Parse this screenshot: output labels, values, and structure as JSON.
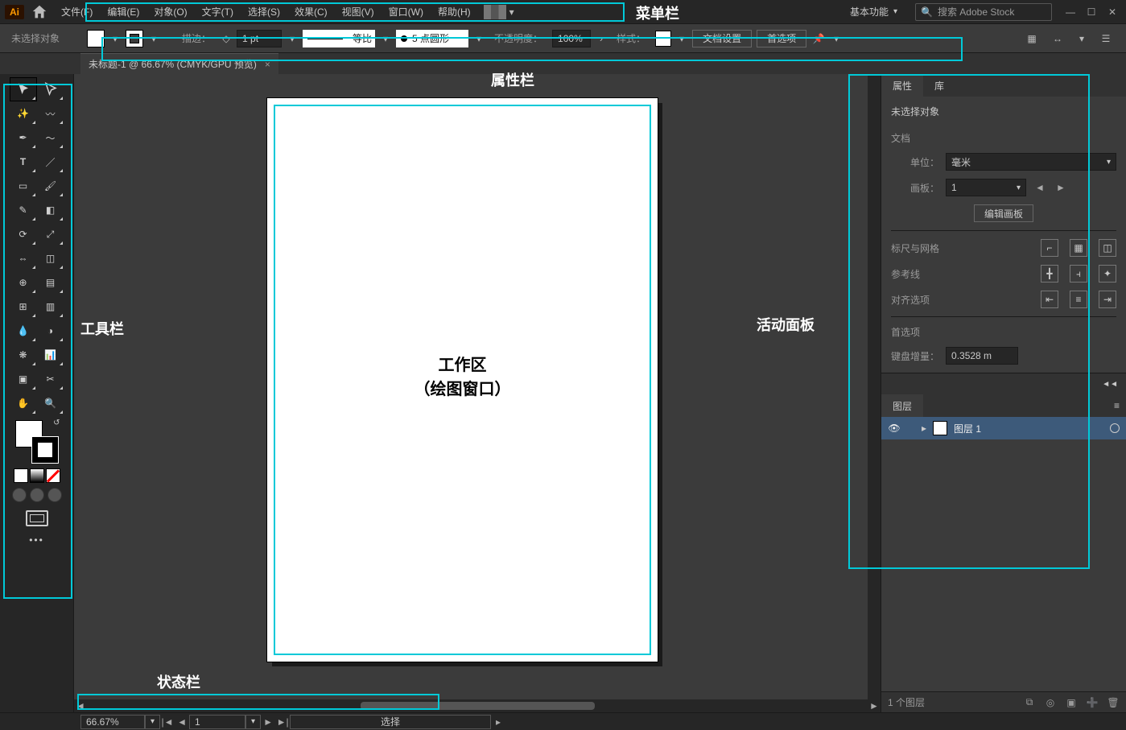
{
  "menubar": {
    "items": [
      "文件(F)",
      "编辑(E)",
      "对象(O)",
      "文字(T)",
      "选择(S)",
      "效果(C)",
      "视图(V)",
      "窗口(W)",
      "帮助(H)"
    ]
  },
  "workspace": {
    "label": "基本功能"
  },
  "search": {
    "placeholder": "搜索 Adobe Stock"
  },
  "controlbar": {
    "no_selection": "未选择对象",
    "stroke_label": "描边：",
    "stroke_weight": "1 pt",
    "brush_label": "等比",
    "profile_label": "5 点圆形",
    "opacity_label": "不透明度：",
    "opacity_value": "100%",
    "style_label": "样式：",
    "doc_setup": "文档设置",
    "prefs": "首选项"
  },
  "doc_tab": {
    "title": "未标题-1 @ 66.67% (CMYK/GPU 预览)"
  },
  "annotations": {
    "menubar": "菜单栏",
    "controlbar": "属性栏",
    "toolbar": "工具栏",
    "canvas1": "工作区",
    "canvas2": "（绘图窗口）",
    "panels": "活动面板",
    "statusbar": "状态栏"
  },
  "properties_panel": {
    "tabs": {
      "properties": "属性",
      "libraries": "库"
    },
    "no_selection": "未选择对象",
    "document": {
      "heading": "文档",
      "units_label": "单位：",
      "units_value": "毫米",
      "artboard_label": "画板：",
      "artboard_value": "1",
      "edit_artboards": "编辑画板"
    },
    "rulers_grid": "标尺与网格",
    "guides": "参考线",
    "align": "对齐选项",
    "prefs_heading": "首选项",
    "kb_increment_label": "键盘增量：",
    "kb_increment_value": "0.3528 m"
  },
  "layers_panel": {
    "title": "图层",
    "layer1": "图层 1",
    "footer_count": "1 个图层"
  },
  "statusbar": {
    "zoom": "66.67%",
    "artboard_nav": "1",
    "tool": "选择"
  }
}
